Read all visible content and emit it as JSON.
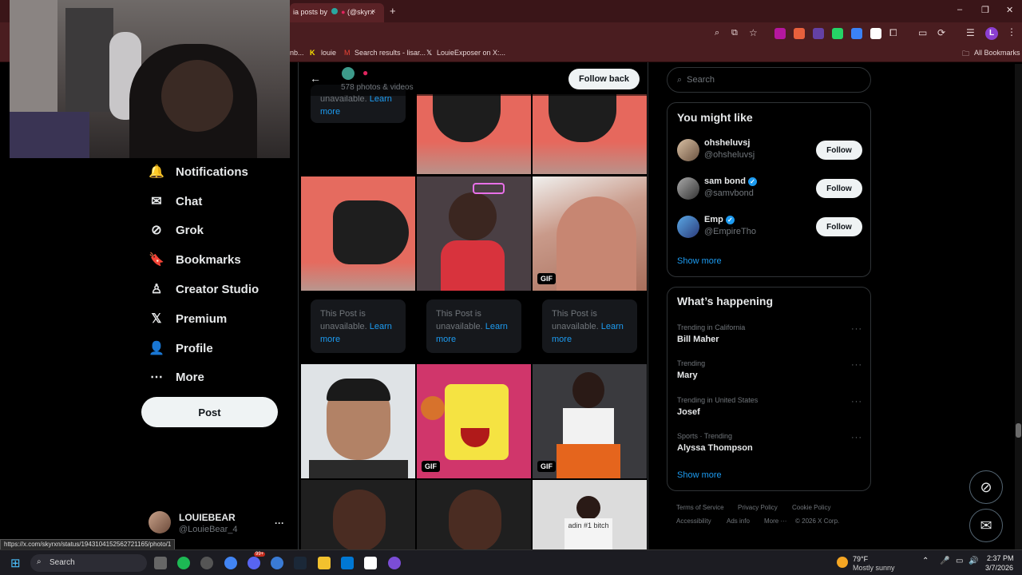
{
  "browser": {
    "tab_title": "ia posts by",
    "tab_title_handle": "(@skyrx",
    "tab_close": "×",
    "new_tab": "+",
    "win_min": "–",
    "win_max": "❐",
    "win_close": "✕",
    "profile_initial": "L",
    "bookmarks": [
      "nb...",
      "louie",
      "Search results - lisar...",
      "LouieExposer on X:..."
    ],
    "all_bookmarks": "All Bookmarks"
  },
  "nav": {
    "items": [
      {
        "label": "Notifications",
        "icon": "bell-icon",
        "glyph": "🔔"
      },
      {
        "label": "Chat",
        "icon": "envelope-icon",
        "glyph": "✉"
      },
      {
        "label": "Grok",
        "icon": "grok-icon",
        "glyph": "⊘"
      },
      {
        "label": "Bookmarks",
        "icon": "bookmark-icon",
        "glyph": "🔖"
      },
      {
        "label": "Creator Studio",
        "icon": "flask-icon",
        "glyph": "♙"
      },
      {
        "label": "Premium",
        "icon": "x-logo-icon",
        "glyph": "𝕏"
      },
      {
        "label": "Profile",
        "icon": "person-icon",
        "glyph": "👤"
      },
      {
        "label": "More",
        "icon": "more-circle-icon",
        "glyph": "⋯"
      }
    ],
    "post_label": "Post",
    "account_name": "LOUIEBEAR",
    "account_handle": "@LouieBear_4",
    "account_more": "···"
  },
  "header": {
    "back": "←",
    "sub": "578 photos & videos",
    "follow_back": "Follow back"
  },
  "media": {
    "unavailable_text": "This Post is unavailable.",
    "learn_more": "Learn more",
    "gif_label": "GIF",
    "partial_unavailable": "unavailable.",
    "partial_learn": "Learn",
    "partial_more": "more",
    "sign_text": "adin #1 bitch"
  },
  "right": {
    "search_placeholder": "Search",
    "might_like_title": "You might like",
    "accounts": [
      {
        "name": "ohsheluvsj",
        "handle": "@ohsheluvsj",
        "verified": false
      },
      {
        "name": "sam bond",
        "handle": "@samvbond",
        "verified": true
      },
      {
        "name": "Emp",
        "handle": "@EmpireTho",
        "verified": true
      }
    ],
    "follow_label": "Follow",
    "show_more": "Show more",
    "happening_title": "What’s happening",
    "trends": [
      {
        "context": "Trending in California",
        "name": "Bill Maher"
      },
      {
        "context": "Trending",
        "name": "Mary"
      },
      {
        "context": "Trending in United States",
        "name": "Josef"
      },
      {
        "context": "Sports · Trending",
        "name": "Alyssa Thompson"
      }
    ],
    "trend_more": "···",
    "footer": [
      "Terms of Service",
      "Privacy Policy",
      "Cookie Policy",
      "Accessibility",
      "Ads info",
      "More ···",
      "© 2026 X Corp."
    ]
  },
  "status_url": "https://x.com/skyrxn/status/1943104152562721165/photo/1",
  "taskbar": {
    "search": "Search",
    "weather_temp": "79°F",
    "weather_desc": "Mostly sunny",
    "time": "2:37 PM",
    "date": "3/7/2026",
    "badge": "99+"
  },
  "colors": {
    "accent": "#1d9bf0",
    "chrome": "#4a1d20",
    "bg": "#000000"
  }
}
